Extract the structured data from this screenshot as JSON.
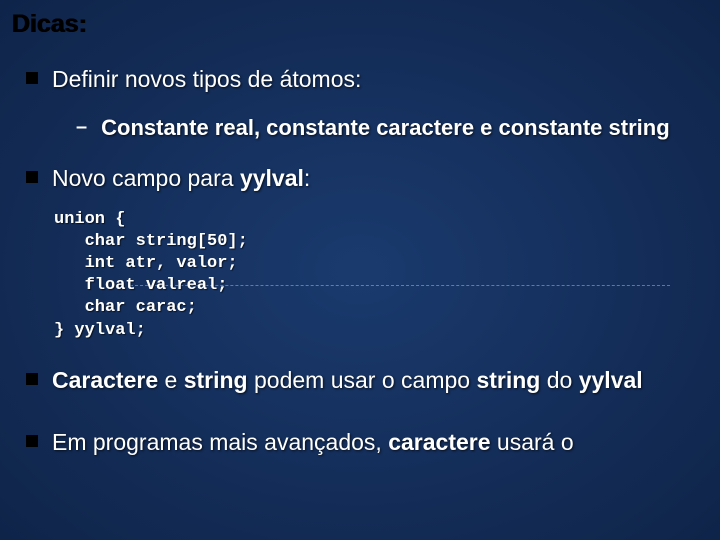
{
  "title": "Dicas:",
  "items": [
    {
      "text": "Definir novos tipos de átomos:"
    }
  ],
  "sub1": {
    "text": "Constante real, constante caractere e constante string"
  },
  "item2_pre": "Novo campo para ",
  "item2_em": "yylval",
  "item2_post": ":",
  "code": "union {\n   char string[50];\n   int atr, valor;\n   float valreal;\n   char carac;\n} yylval;",
  "item3_p1": "Caractere",
  "item3_p2": " e ",
  "item3_p3": "string",
  "item3_p4": " podem usar o campo ",
  "item3_p5": "string",
  "item3_p6": " do ",
  "item3_p7": "yylval",
  "item4_p1": "Em programas mais avançados, ",
  "item4_p2": "caractere",
  "item4_p3": " usará o"
}
